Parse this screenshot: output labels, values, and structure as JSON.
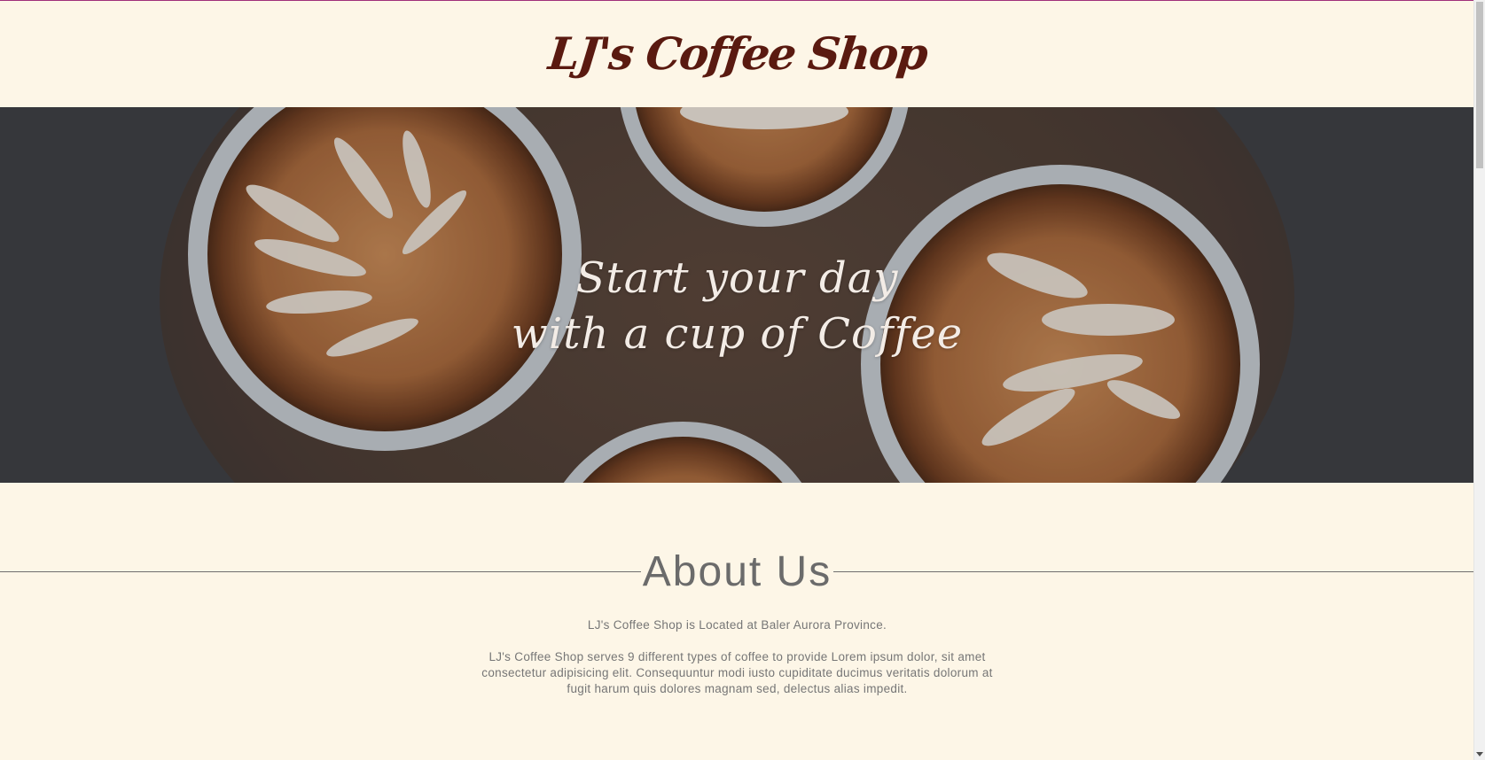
{
  "header": {
    "logo_text": "LJ's Coffee Shop"
  },
  "hero": {
    "line1": "Start your day",
    "line2": "with a cup of Coffee"
  },
  "about": {
    "title": "About Us",
    "paragraph1": "LJ's Coffee Shop is Located at Baler Aurora Province.",
    "paragraph2": "LJ's Coffee Shop serves 9 different types of coffee to provide Lorem ipsum dolor, sit amet consectetur adipisicing elit. Consequuntur modi iusto cupiditate ducimus veritatis dolorum at fugit harum quis dolores magnam sed, delectus alias impedit."
  },
  "colors": {
    "page_background": "#fdf6e7",
    "logo": "#5a1a10",
    "top_border": "#a0307a",
    "about_text": "#767676"
  }
}
